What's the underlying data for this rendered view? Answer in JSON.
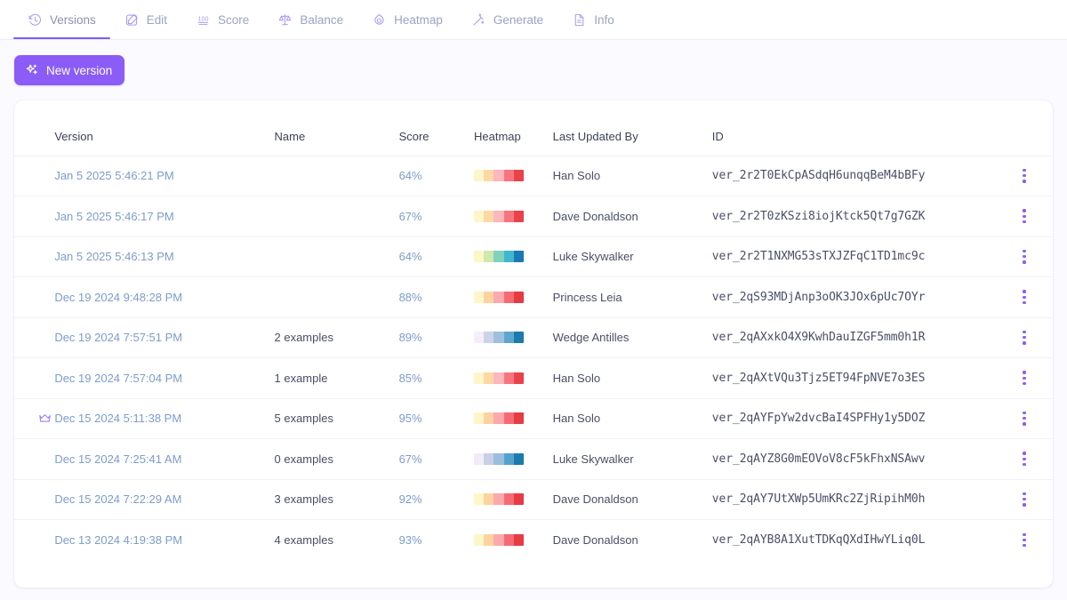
{
  "tabs": [
    {
      "label": "Versions",
      "icon": "history-icon",
      "active": true
    },
    {
      "label": "Edit",
      "icon": "pencil-square-icon",
      "active": false
    },
    {
      "label": "Score",
      "icon": "hundred-points-icon",
      "active": false
    },
    {
      "label": "Balance",
      "icon": "scales-icon",
      "active": false
    },
    {
      "label": "Heatmap",
      "icon": "heatmap-icon",
      "active": false
    },
    {
      "label": "Generate",
      "icon": "magic-wand-icon",
      "active": false
    },
    {
      "label": "Info",
      "icon": "document-info-icon",
      "active": false
    }
  ],
  "toolbar": {
    "new_version_label": "New version",
    "new_version_icon": "sparkles-icon"
  },
  "table": {
    "columns": [
      "Version",
      "Name",
      "Score",
      "Heatmap",
      "Last Updated By",
      "ID"
    ],
    "rows": [
      {
        "starred": false,
        "version": "Jan 5 2025 5:46:21 PM",
        "name": "",
        "score": "64%",
        "heatmap": [
          "#fdf6c8",
          "#fcd9a3",
          "#fbb7bb",
          "#f7757f",
          "#e8434a"
        ],
        "updated_by": "Han Solo",
        "id": "ver_2r2T0EkCpASdqH6unqqBeM4bBFy"
      },
      {
        "starred": false,
        "version": "Jan 5 2025 5:46:17 PM",
        "name": "",
        "score": "67%",
        "heatmap": [
          "#fdf6c8",
          "#fcd9a3",
          "#fbb7bb",
          "#f7757f",
          "#e8434a"
        ],
        "updated_by": "Dave Donaldson",
        "id": "ver_2r2T0zKSzi8iojKtck5Qt7g7GZK"
      },
      {
        "starred": false,
        "version": "Jan 5 2025 5:46:13 PM",
        "name": "",
        "score": "64%",
        "heatmap": [
          "#fbf8c6",
          "#cfe8ae",
          "#7fd2bb",
          "#40b6cf",
          "#1a79b4"
        ],
        "updated_by": "Luke Skywalker",
        "id": "ver_2r2T1NXMG53sTXJZFqC1TD1mc9c"
      },
      {
        "starred": false,
        "version": "Dec 19 2024 9:48:28 PM",
        "name": "",
        "score": "88%",
        "heatmap": [
          "#fdf6c8",
          "#fcd3a0",
          "#fba9ad",
          "#f66a73",
          "#e53c43"
        ],
        "updated_by": "Princess Leia",
        "id": "ver_2qS93MDjAnp3oOK3JOx6pUc7OYr"
      },
      {
        "starred": false,
        "version": "Dec 19 2024 7:57:51 PM",
        "name": "2 examples",
        "score": "89%",
        "heatmap": [
          "#f5eefa",
          "#ccd2e8",
          "#9fc0dd",
          "#5fa6cf",
          "#1b7bab"
        ],
        "updated_by": "Wedge Antilles",
        "id": "ver_2qAXxkO4X9KwhDauIZGF5mm0h1R"
      },
      {
        "starred": false,
        "version": "Dec 19 2024 7:57:04 PM",
        "name": "1 example",
        "score": "85%",
        "heatmap": [
          "#fdf6c8",
          "#fcd9a3",
          "#fbb7bb",
          "#f7757f",
          "#e8434a"
        ],
        "updated_by": "Han Solo",
        "id": "ver_2qAXtVQu3Tjz5ET94FpNVE7o3ES"
      },
      {
        "starred": true,
        "version": "Dec 15 2024 5:11:38 PM",
        "name": "5 examples",
        "score": "95%",
        "heatmap": [
          "#fdf6c8",
          "#fcd3a0",
          "#fba9ad",
          "#f66a73",
          "#e53c43"
        ],
        "updated_by": "Han Solo",
        "id": "ver_2qAYFpYw2dvcBaI4SPFHy1y5DOZ"
      },
      {
        "starred": false,
        "version": "Dec 15 2024 7:25:41 AM",
        "name": "0 examples",
        "score": "67%",
        "heatmap": [
          "#f3ebf8",
          "#c8cfe6",
          "#9abedc",
          "#52a2cd",
          "#1b7bab"
        ],
        "updated_by": "Luke Skywalker",
        "id": "ver_2qAYZ8G0mEOVoV8cF5kFhxNSAwv"
      },
      {
        "starred": false,
        "version": "Dec 15 2024 7:22:29 AM",
        "name": "3 examples",
        "score": "92%",
        "heatmap": [
          "#fdf6c8",
          "#fcd3a0",
          "#fba9ad",
          "#f66a73",
          "#e53c43"
        ],
        "updated_by": "Dave Donaldson",
        "id": "ver_2qAY7UtXWp5UmKRc2ZjRipihM0h"
      },
      {
        "starred": false,
        "version": "Dec 13 2024 4:19:38 PM",
        "name": "4 examples",
        "score": "93%",
        "heatmap": [
          "#fdf6c8",
          "#fcd3a0",
          "#fba9ad",
          "#f66a73",
          "#e53c43"
        ],
        "updated_by": "Dave Donaldson",
        "id": "ver_2qAYB8A1XutTDKqQXdIHwYLiq0L"
      }
    ]
  },
  "colors": {
    "accent": "#8b5cf6",
    "tab_icon": "#a89cf0",
    "link": "#7d9ccb",
    "page_bg": "#fbfaff",
    "card_bg": "#ffffff"
  },
  "row_menu_icon": "kebab-menu-icon",
  "star_icon": "crown-icon"
}
